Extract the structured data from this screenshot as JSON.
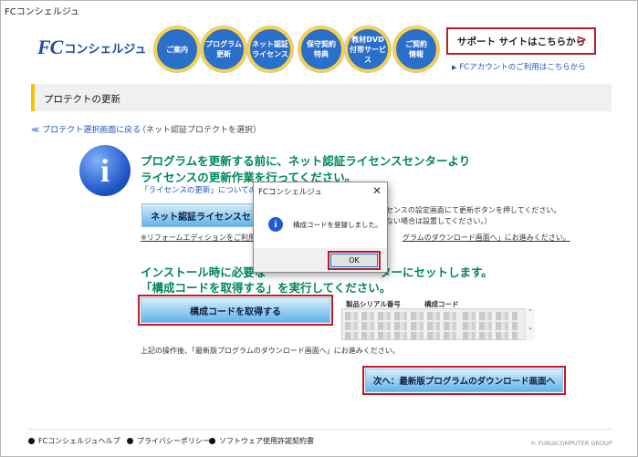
{
  "window": {
    "title": "FCコンシェルジュ"
  },
  "header": {
    "logo_fc": "FC",
    "logo_name": "コンシェルジュ",
    "nav": [
      {
        "label": "ご案内"
      },
      {
        "label": "プログラム\n更新"
      },
      {
        "label": "ネット認証\nライセンス"
      },
      {
        "label": "保守契約\n特典"
      },
      {
        "label": "教材DVD\n付帯サービス"
      },
      {
        "label": "ご契約\n情報"
      }
    ],
    "support_label": "サポート サイトはこちらから",
    "support_chevron": ">",
    "account_link": "FCアカウントのご利用はこちらから"
  },
  "section": {
    "title": "プロテクトの更新"
  },
  "back": {
    "link": "≪ プロテクト選択画面に戻る",
    "note": "（ネット認証プロテクトを選択）"
  },
  "info": {
    "line1": "プログラムを更新する前に、ネット認証ライセンスセンターより",
    "line2": "ライセンスの更新作業を行ってください。",
    "small_link": "「ライセンスの更新」についての詳し",
    "license_button": "ネット認証ライセンスセ",
    "right_note1": "センスの設定画面にて更新ボタンを押してください。",
    "right_note2": "ない場合は設置してください。）",
    "remark_left": "※リフォームエディションをご利用の",
    "remark_right": "グラムのダウンロード画面へ」にお進みください。"
  },
  "install": {
    "line1": "インストール時に必要な",
    "line1_right": "ターにセットします。",
    "line2": "「構成コードを取得する」を実行してください。",
    "get_code_button": "構成コードを取得する",
    "serial_header": "製品シリアル番号",
    "code_header": "構成コード",
    "after_note": "上記の操作後、「最新版プログラムのダウンロード画面へ」にお進みください。",
    "next_button": "次へ：最新版プログラムのダウンロード画面へ"
  },
  "footer": {
    "items": [
      "FCコンシェルジュヘルプ",
      "プライバシーポリシー",
      "ソフトウェア使用許諾契約書"
    ],
    "copyright": "© FUKUICOMPUTER GROUP"
  },
  "dialog": {
    "title": "FCコンシェルジュ",
    "close": "✕",
    "message": "構成コードを登録しました。",
    "ok": "OK"
  },
  "colors": {
    "accent_green": "#00875a",
    "link_blue": "#1e55c2",
    "highlight_red": "#c01a26",
    "nav_blue": "#2a6fc9"
  }
}
